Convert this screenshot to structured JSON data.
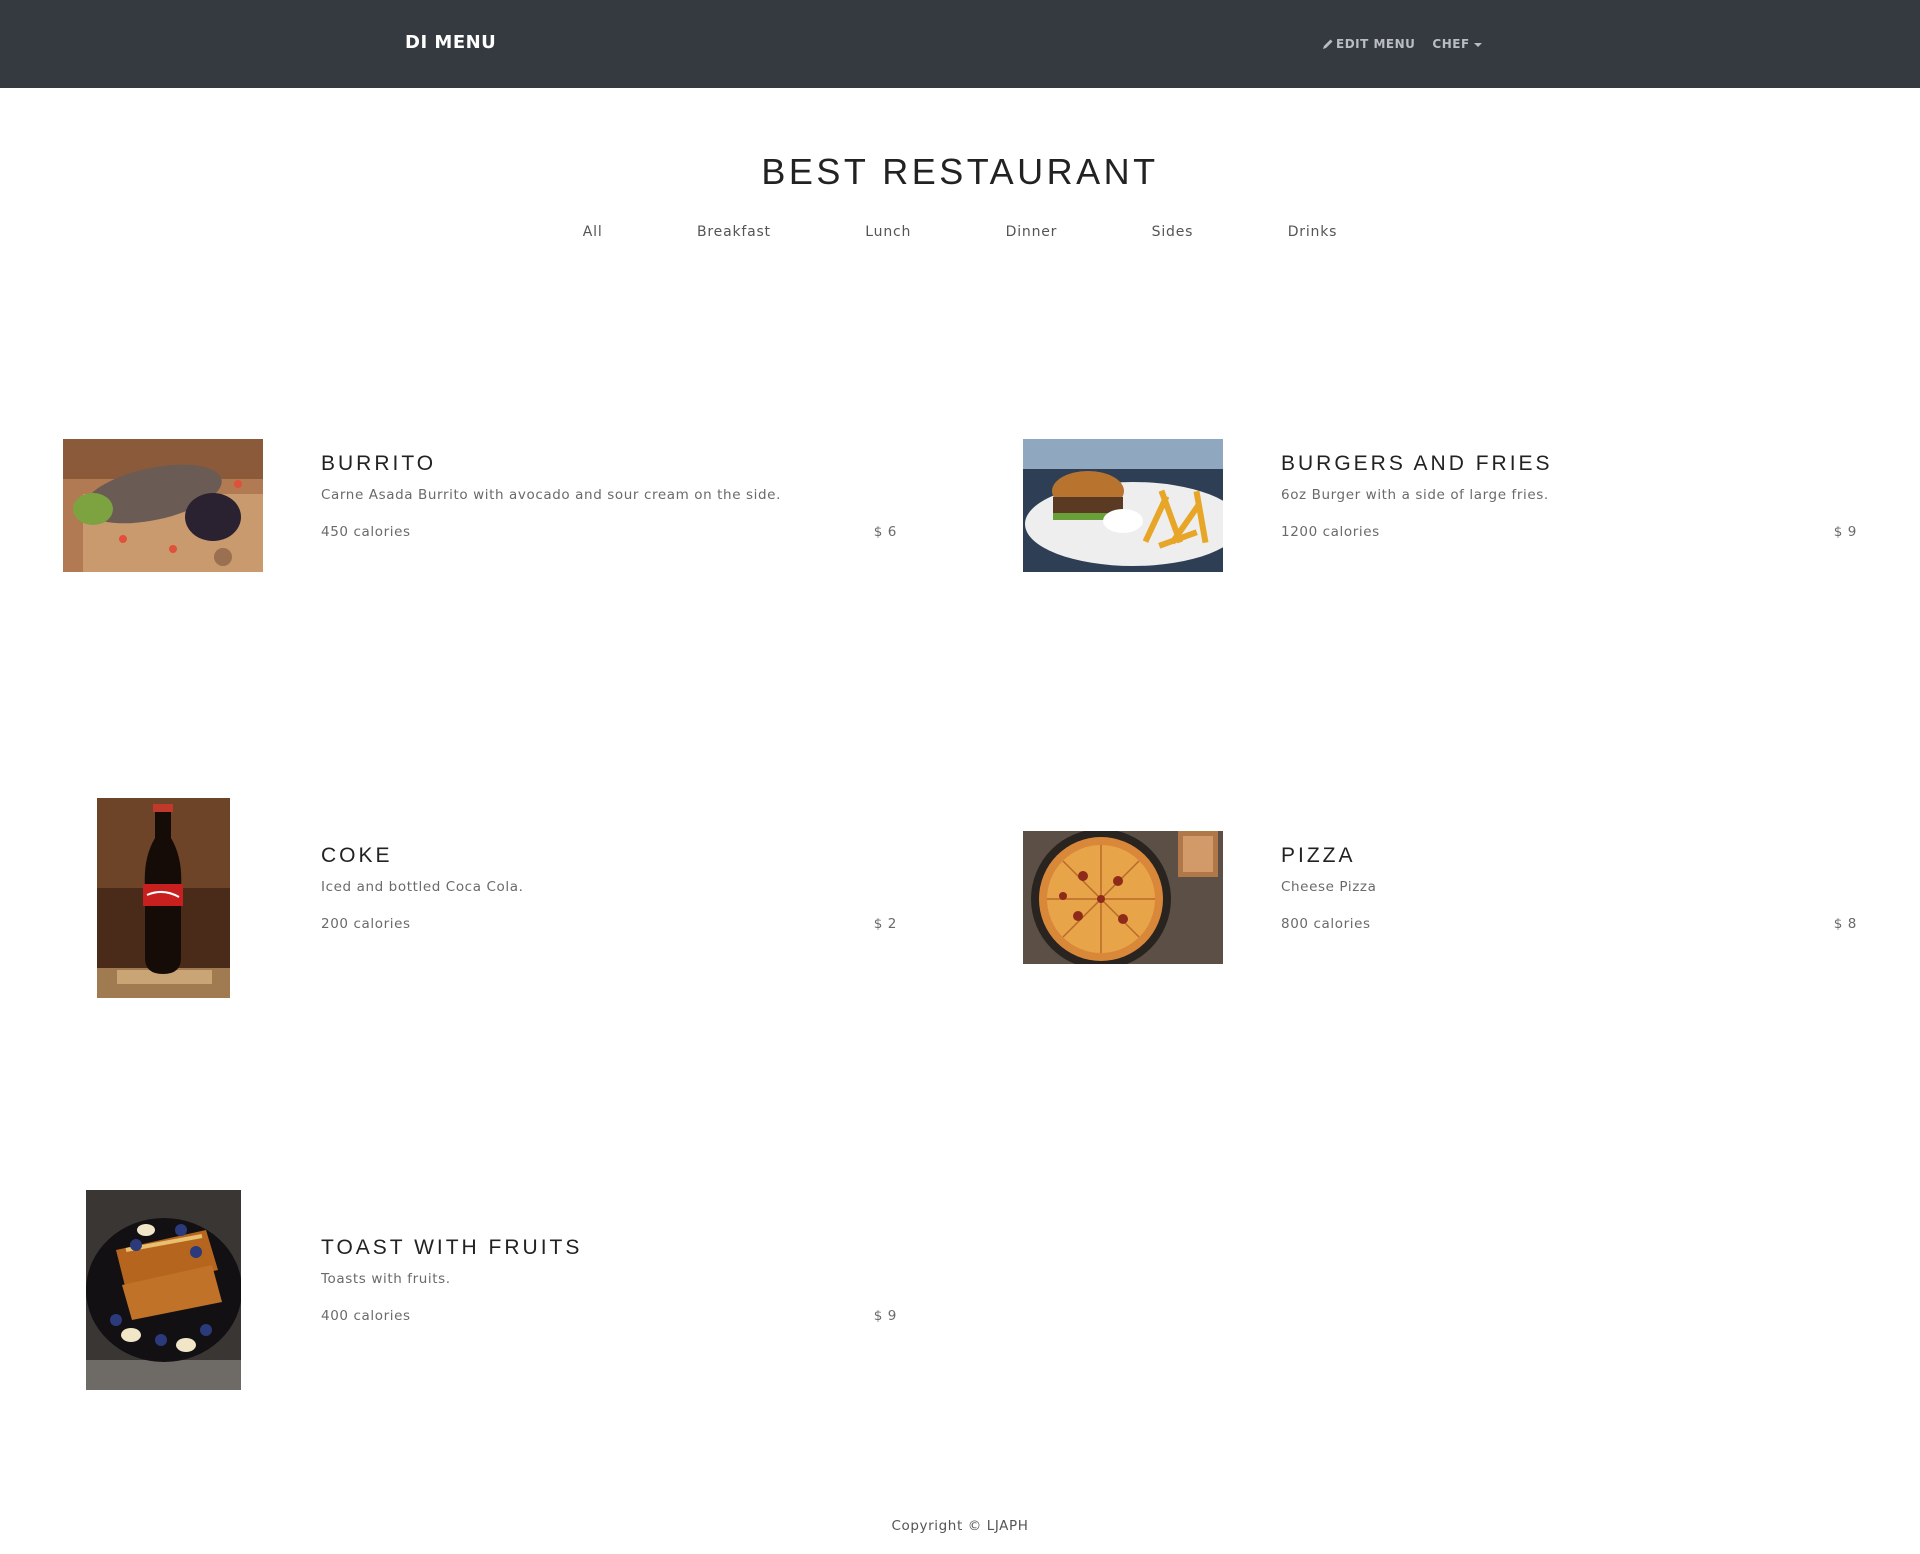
{
  "navbar": {
    "brand": "DI MENU",
    "edit_menu": "EDIT MENU",
    "user": "CHEF"
  },
  "header": {
    "title": "BEST RESTAURANT",
    "filters": [
      "All",
      "Breakfast",
      "Lunch",
      "Dinner",
      "Sides",
      "Drinks"
    ]
  },
  "items": [
    {
      "name": "BURRITO",
      "description": "Carne Asada Burrito with avocado and sour cream on the side.",
      "calories": "450 calories",
      "price": "$ 6"
    },
    {
      "name": "BURGERS AND FRIES",
      "description": "6oz Burger with a side of large fries.",
      "calories": "1200 calories",
      "price": "$ 9"
    },
    {
      "name": "COKE",
      "description": "Iced and bottled Coca Cola.",
      "calories": "200 calories",
      "price": "$ 2"
    },
    {
      "name": "PIZZA",
      "description": "Cheese Pizza",
      "calories": "800 calories",
      "price": "$ 8"
    },
    {
      "name": "TOAST WITH FRUITS",
      "description": "Toasts with fruits.",
      "calories": "400 calories",
      "price": "$ 9"
    }
  ],
  "footer": {
    "copyright": "Copyright © LJAPH"
  }
}
